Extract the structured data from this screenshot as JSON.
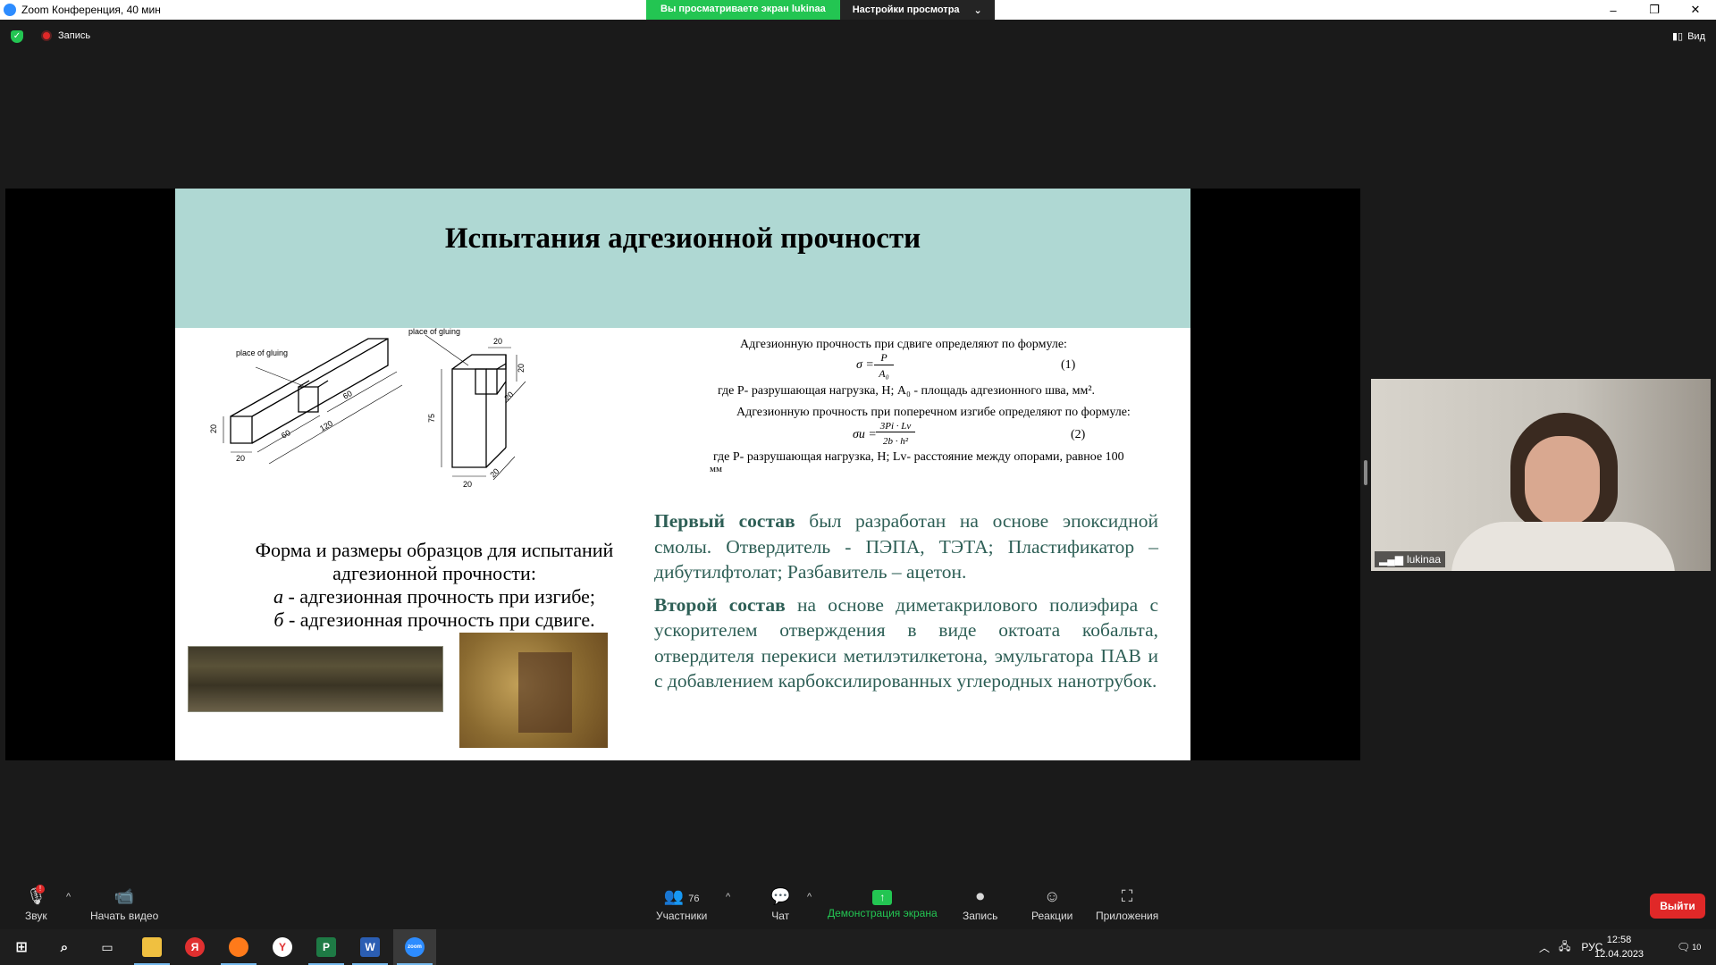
{
  "window": {
    "title": "Zoom Конференция, 40 мин",
    "banner_text": "Вы просматриваете экран lukinaa",
    "view_options": "Настройки просмотра",
    "minimize": "–",
    "restore": "❐",
    "close": "✕"
  },
  "top_bar": {
    "recording_label": "Запись",
    "view_label": "Вид"
  },
  "slide": {
    "title": "Испытания адгезионной прочности",
    "drawing_labels": {
      "place_gluing_a": "place of gluing",
      "place_gluing_b": "place of gluing",
      "d20a": "20",
      "d20b": "20",
      "d60a": "60",
      "d60b": "60",
      "d120": "120",
      "d75": "75",
      "d20c": "20",
      "d20d": "20",
      "d20e": "20",
      "d20f": "20",
      "d20g": "20"
    },
    "caption": {
      "line1": "Форма и размеры образцов для испытаний",
      "line2": "адгезионной прочности:",
      "line3_letter": "а",
      "line3_rest": " - адгезионная прочность при изгибе;",
      "line4_letter": "б",
      "line4_rest": " - адгезионная прочность при сдвиге."
    },
    "formulas": {
      "shear_intro": "Адгезионную прочность при сдвиге определяют по формуле:",
      "f1_lhs": "σ =",
      "f1_num": "P",
      "f1_den": "A₀",
      "f1_number": "(1)",
      "f1_where": "где P- разрушающая нагрузка, Н; A₀ - площадь адгезионного шва, мм².",
      "bend_intro": "Адгезионную прочность при поперечном изгибе определяют по формуле:",
      "f2_lhs": "σи =",
      "f2_num": "3Pi · Lv",
      "f2_den": "2b · h²",
      "f2_number": "(2)",
      "f2_where": "где P- разрушающая нагрузка, Н;  Lv- расстояние между опорами, равное 100",
      "f2_unit": "мм"
    },
    "composition1_bold": "Первый состав",
    "composition1_text": " был разработан на основе эпоксидной смолы. Отвердитель - ПЭПА, ТЭТА; Пластификатор – дибутилфтолат; Разбавитель – ацетон.",
    "composition2_bold": "Второй состав",
    "composition2_text": " на основе диметакрилового полиэфира с ускорителем отверждения в виде октоата кобальта, отвердителя перекиси метилэтилкетона, эмульгатора ПАВ и с добавлением карбоксилированных углеродных нанотрубок."
  },
  "participant_video": {
    "name": "lukinaa"
  },
  "controls": {
    "audio": "Звук",
    "video": "Начать видео",
    "participants": "Участники",
    "participants_count": "76",
    "chat": "Чат",
    "share": "Демонстрация экрана",
    "record": "Запись",
    "reactions": "Реакции",
    "apps": "Приложения",
    "leave": "Выйти",
    "audio_badge": "!"
  },
  "taskbar": {
    "lang": "РУС",
    "time": "12:58",
    "date": "12.04.2023",
    "notif_count": "10"
  }
}
